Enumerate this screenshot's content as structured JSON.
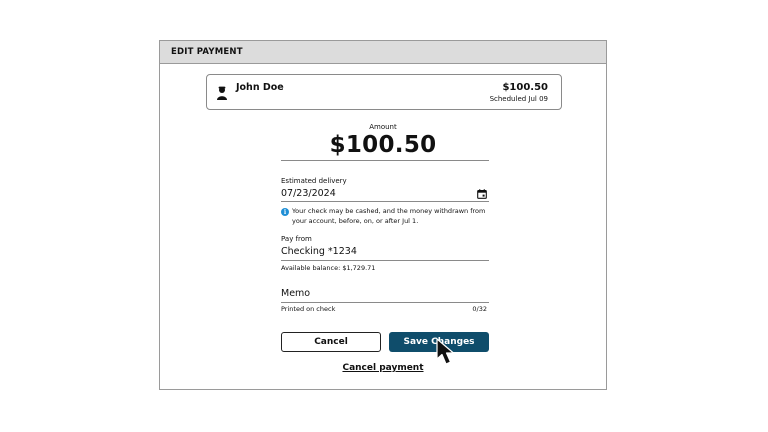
{
  "dialog": {
    "title": "EDIT PAYMENT"
  },
  "payee": {
    "icon": "person-icon",
    "name": "John Doe",
    "amount": "$100.50",
    "scheduled": "Scheduled Jul 09"
  },
  "amount": {
    "label": "Amount",
    "value": "$100.50"
  },
  "delivery": {
    "label": "Estimated delivery",
    "value": "07/23/2024",
    "icon": "calendar-icon",
    "info_icon": "info-icon",
    "info_text": "Your check may be cashed, and the money withdrawn from your account, before, on, or after Jul 1."
  },
  "pay_from": {
    "label": "Pay from",
    "value": "Checking *1234",
    "balance": "Available balance: $1,729.71"
  },
  "memo": {
    "placeholder": "Memo",
    "helper": "Printed on check",
    "counter": "0/32"
  },
  "buttons": {
    "cancel": "Cancel",
    "save": "Save Changes",
    "cancel_payment": "Cancel payment"
  },
  "colors": {
    "primary": "#0f4d6b",
    "header_bg": "#dcdcdc",
    "info": "#1f8fd6"
  }
}
